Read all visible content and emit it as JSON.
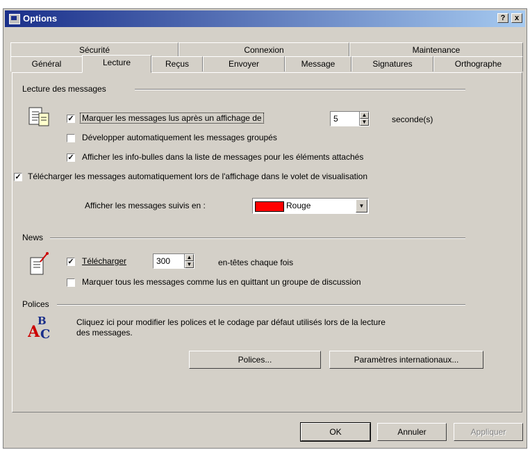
{
  "window": {
    "title": "Options",
    "help_button": "?",
    "close_button": "x"
  },
  "tabs_row1": [
    {
      "label": "Sécurité"
    },
    {
      "label": "Connexion"
    },
    {
      "label": "Maintenance"
    }
  ],
  "tabs_row2": [
    {
      "label": "Général"
    },
    {
      "label": "Lecture",
      "active": true
    },
    {
      "label": "Reçus"
    },
    {
      "label": "Envoyer"
    },
    {
      "label": "Message"
    },
    {
      "label": "Signatures"
    },
    {
      "label": "Orthographe"
    }
  ],
  "reading": {
    "group_title": "Lecture des messages",
    "mark_read": {
      "checked": true,
      "label": "Marquer les messages lus après un affichage de",
      "seconds_value": "5",
      "unit": "seconde(s)"
    },
    "expand_groups": {
      "checked": false,
      "label": "Développer automatiquement les messages groupés"
    },
    "show_tooltips": {
      "checked": true,
      "label": "Afficher les info-bulles dans la liste de messages pour les éléments attachés"
    },
    "auto_download": {
      "checked": true,
      "label": "Télécharger les messages automatiquement lors de l'affichage dans le volet de visualisation"
    },
    "followed_label": "Afficher les messages suivis en :",
    "followed_color_name": "Rouge",
    "followed_color": "#ff0000"
  },
  "news": {
    "group_title": "News",
    "download": {
      "checked": true,
      "label": "Télécharger",
      "value": "300",
      "suffix": "en-têtes chaque fois"
    },
    "mark_all": {
      "checked": false,
      "label": "Marquer tous les messages comme lus en quittant un groupe de discussion"
    }
  },
  "fonts": {
    "group_title": "Polices",
    "description_line1": "Cliquez ici pour modifier les polices et le codage par défaut utilisés lors de la lecture",
    "description_line2": "des messages.",
    "fonts_button": "Polices...",
    "intl_button": "Paramètres internationaux..."
  },
  "footer": {
    "ok": "OK",
    "cancel": "Annuler",
    "apply": "Appliquer"
  },
  "colors": {
    "face": "#d4d0c8",
    "title_start": "#1a2f8a",
    "title_end": "#a6caf0"
  }
}
